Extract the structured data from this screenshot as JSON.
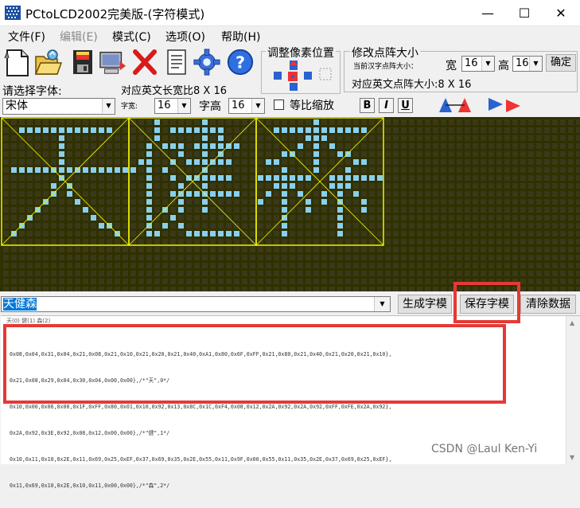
{
  "window": {
    "title": "PCtoLCD2002完美版-(字符模式)",
    "minimize_glyph": "—",
    "maximize_glyph": "☐",
    "close_glyph": "✕"
  },
  "menu": [
    {
      "label": "文件(F)",
      "enabled": true
    },
    {
      "label": "编辑(E)",
      "enabled": false
    },
    {
      "label": "模式(C)",
      "enabled": true
    },
    {
      "label": "选项(O)",
      "enabled": true
    },
    {
      "label": "帮助(H)",
      "enabled": true
    }
  ],
  "toolbar_icons": [
    "new-file-icon",
    "open-folder-icon",
    "save-disk-icon",
    "computer-icon",
    "delete-x-icon",
    "document-icon",
    "gear-icon",
    "help-icon"
  ],
  "adjust_group": {
    "title": "调整像素位置"
  },
  "resize_group": {
    "title": "修改点阵大小",
    "current_label": "当前汉字点阵大小：",
    "width_label": "宽",
    "width_value": "16",
    "height_label": "高",
    "height_value": "16",
    "confirm_label": "确定",
    "english_size": "对应英文点阵大小:8 X 16"
  },
  "font": {
    "choose_label": "请选择字体:",
    "english_size": "对应英文长宽比8 X 16",
    "font_name": "宋体",
    "width_label": "字宽:",
    "width_value": "16",
    "height_label": "字高",
    "height_value": "16",
    "ratio_label": "等比缩放",
    "bold": "B",
    "italic": "I",
    "underline": "U"
  },
  "text_input": {
    "value": "天健森"
  },
  "buttons": {
    "generate": "生成字模",
    "save": "保存字模",
    "clear": "清除数据"
  },
  "output": {
    "tabs": "天(0) 健(1) 森(2)",
    "lines": [
      "0x08,0x04,0x31,0x04,0x21,0x08,0x21,0x10,0x21,0x20,0x21,0x40,0xA1,0x80,0x6F,0xFF,0x21,0x80,0x21,0x40,0x21,0x20,0x21,0x10},",
      "0x21,0x08,0x29,0x04,0x30,0x04,0x00,0x00},/*\"天\",0*/",
      "0x10,0x00,0x06,0x00,0x1F,0xFF,0x80,0x01,0x10,0x92,0x13,0x8C,0x1C,0xF4,0x08,0x12,0x2A,0x92,0x2A,0x92,0xFF,0xFE,0x2A,0x92},",
      "0x2A,0x92,0x3E,0x92,0x08,0x12,0x00,0x00},/*\"健\",1*/",
      "0x10,0x11,0x10,0x2E,0x11,0x69,0x25,0xEF,0x37,0x69,0x35,0x2E,0x55,0x11,0x9F,0x00,0x55,0x11,0x35,0x2E,0x37,0x69,0x25,0xEF},",
      "0x11,0x69,0x10,0x2E,0x10,0x11,0x00,0x00},/*\"森\",2*/"
    ]
  },
  "glyphs": [
    [
      "................",
      "..############..",
      ".......#........",
      ".......#........",
      ".......#........",
      ".......#........",
      ".###############",
      ".......#........",
      "......#.#.......",
      "......#.#.......",
      ".....#...#......",
      "....#.....#.....",
      "...#.......#....",
      "..#.........##..",
      ".#............#.",
      "................"
    ],
    [
      "...#.....#......",
      "...#.#######....",
      "...#.....#.#....",
      "..#.###.######..",
      "..#...#..#.#....",
      ".##..#.######...",
      "#.#.#....#......",
      "..#..#.######...",
      "..#...#..#......",
      "..#..#########..",
      "..#...#..#......",
      "..#.#.#..#......",
      "..#..#..........",
      "..#.#.#.........",
      "..##...#######..",
      "................"
    ],
    [
      ".......#........",
      "..############..",
      "......###.......",
      ".....#.#.#......",
      "...##..#..##....",
      ".##....#....##..",
      "...#...#...#....",
      "#######..#######",
      "..###....###....",
      ".#.#.#..#.#.#...",
      "#..#..#.#.#..#..",
      "...#..#...#..#..",
      "...#......#.....",
      "...#......#.....",
      "...#......#.....",
      "................"
    ]
  ],
  "colors": {
    "grid_bg": "#303000",
    "pixel_off": "#3a3a1a",
    "pixel_on": "#88d0ee",
    "frame": "#f5f500",
    "highlight": "#e53935"
  },
  "watermark": "CSDN @Laul Ken-Yi"
}
